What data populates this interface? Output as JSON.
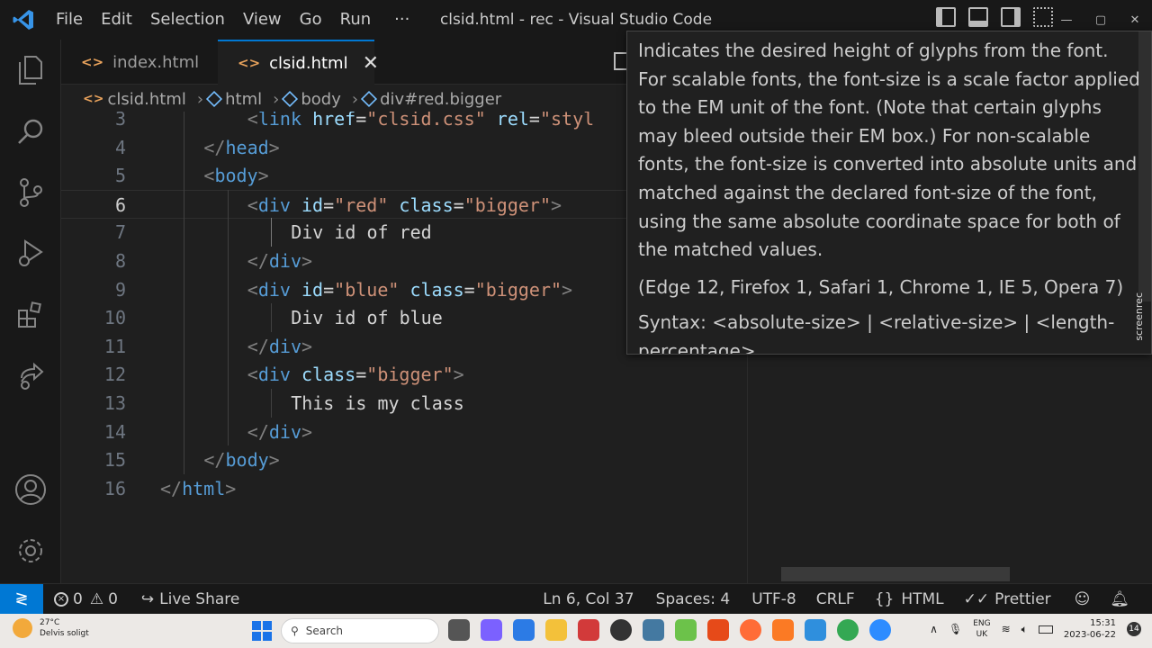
{
  "titlebar": {
    "menu": [
      "File",
      "Edit",
      "Selection",
      "View",
      "Go",
      "Run",
      "···"
    ],
    "window_title": "clsid.html - rec - Visual Studio Code"
  },
  "tabs": [
    {
      "label": "index.html",
      "icon": "<>",
      "active": false
    },
    {
      "label": "clsid.html",
      "icon": "<>",
      "active": true,
      "close": "✕"
    }
  ],
  "breadcrumb": {
    "file": "clsid.html",
    "items": [
      "html",
      "body",
      "div#red.bigger"
    ]
  },
  "editor": {
    "current_line": 6,
    "lines": [
      {
        "n": "3",
        "text": "<link href=\"clsid.css\" rel=\"styl"
      },
      {
        "n": "4",
        "text": "</head>"
      },
      {
        "n": "5",
        "text": "<body>"
      },
      {
        "n": "6",
        "text": "<div id=\"red\" class=\"bigger\">"
      },
      {
        "n": "7",
        "text": "Div id of red"
      },
      {
        "n": "8",
        "text": "</div>"
      },
      {
        "n": "9",
        "text": "<div id=\"blue\" class=\"bigger\">"
      },
      {
        "n": "10",
        "text": "Div id of blue"
      },
      {
        "n": "11",
        "text": "</div>"
      },
      {
        "n": "12",
        "text": "<div class=\"bigger\">"
      },
      {
        "n": "13",
        "text": "This is my class"
      },
      {
        "n": "14",
        "text": "</div>"
      },
      {
        "n": "15",
        "text": "</body>"
      },
      {
        "n": "16",
        "text": "</html>"
      }
    ]
  },
  "hover": {
    "description": "Indicates the desired height of glyphs from the font. For scalable fonts, the font-size is a scale factor applied to the EM unit of the font. (Note that certain glyphs may bleed outside their EM box.) For non-scalable fonts, the font-size is converted into absolute units and matched against the declared font-size of the font, using the same absolute coordinate space for both of the matched values.",
    "browsers": "(Edge 12, Firefox 1, Safari 1, Chrome 1, IE 5, Opera 7)",
    "syntax": "Syntax: <absolute-size> | <relative-size> | <length-percentage>",
    "watermark": "screenrec"
  },
  "statusbar": {
    "errors": "0",
    "warnings": "0",
    "live_share": "Live Share",
    "position": "Ln 6, Col 37",
    "spaces": "Spaces: 4",
    "encoding": "UTF-8",
    "eol": "CRLF",
    "language": "HTML",
    "prettier": "Prettier"
  },
  "taskbar": {
    "temperature": "27°C",
    "weather": "Delvis soligt",
    "search_placeholder": "Search",
    "lang": "ENG",
    "region": "UK",
    "time": "15:31",
    "date": "2023-06-22",
    "notifications": "14"
  },
  "colors": {
    "accent": "#0078d4",
    "tag": "#569cd6",
    "attribute": "#9cdcfe",
    "string": "#ce9178"
  }
}
